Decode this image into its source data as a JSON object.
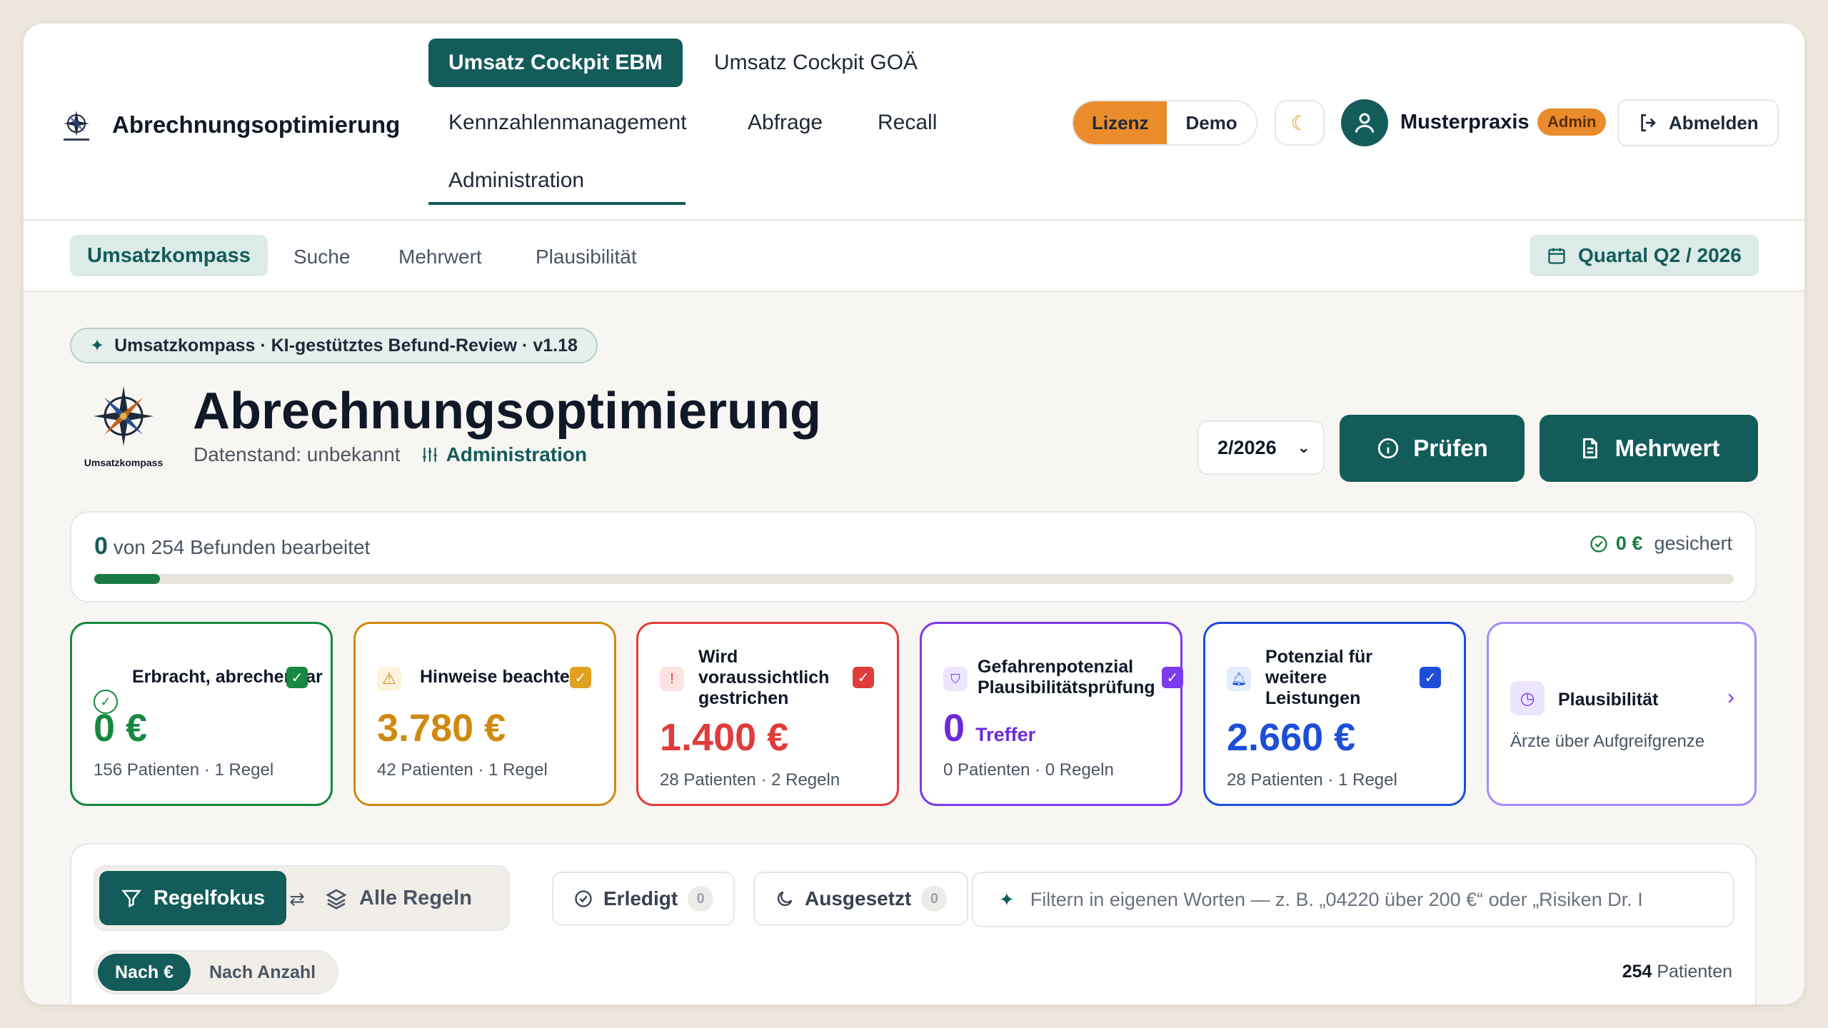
{
  "app": {
    "title": "Abrechnungsoptimierung"
  },
  "nav": {
    "umsatz_ebm": "Umsatz Cockpit EBM",
    "umsatz_goa": "Umsatz Cockpit GOÄ",
    "kennzahlen": "Kennzahlenmanagement",
    "abfrage": "Abfrage",
    "recall": "Recall",
    "administration": "Administration"
  },
  "header": {
    "lizenz": "Lizenz",
    "demo": "Demo",
    "user_name": "Musterpraxis",
    "role_badge": "Admin",
    "logout": "Abmelden"
  },
  "subnav": {
    "tabs": [
      "Umsatzkompass",
      "Suche",
      "Mehrwert",
      "Plausibilität"
    ],
    "quarter": "Quartal Q2 / 2026"
  },
  "hero": {
    "chip": "Umsatzkompass · KI-gestütztes Befund-Review · v1.18",
    "logo_label": "Umsatzkompass",
    "title": "Abrechnungsoptimierung",
    "datenstand": "Datenstand: unbekannt",
    "admin_link": "Administration",
    "period_select": "2/2026",
    "pruefen": "Prüfen",
    "mehrwert": "Mehrwert"
  },
  "progress": {
    "count": "0",
    "text": "von 254 Befunden bearbeitet",
    "secured_value": "0 €",
    "secured_label": "gesichert",
    "fraction": 0.04
  },
  "kpis": [
    {
      "title": "Erbracht, abrechenbar",
      "value": "0 €",
      "sub": "156 Patienten · 1 Regel",
      "color": "#16883f"
    },
    {
      "title": "Hinweise beachten",
      "value": "3.780 €",
      "sub": "42 Patienten · 1 Regel",
      "color": "#d08a10"
    },
    {
      "title": "Wird voraussichtlich gestrichen",
      "value": "1.400 €",
      "sub": "28 Patienten · 2 Regeln",
      "color": "#e03c3c"
    },
    {
      "title": "Gefahrenpotenzial Plausibilitätsprüfung",
      "value": "0",
      "value_suffix": "Treffer",
      "sub": "0 Patienten · 0 Regeln",
      "color": "#7c3aed"
    },
    {
      "title": "Potenzial für weitere Leistungen",
      "value": "2.660 €",
      "sub": "28 Patienten · 1 Regel",
      "color": "#1d4ed8"
    },
    {
      "title": "Plausibilität",
      "sub": "Ärzte über Aufgreifgrenze",
      "color": "#a78bfa"
    }
  ],
  "filters": {
    "regelfokus": "Regelfokus",
    "alle_regeln": "Alle Regeln",
    "erledigt": "Erledigt",
    "erledigt_count": "0",
    "ausgesetzt": "Ausgesetzt",
    "ausgesetzt_count": "0",
    "search_placeholder": "Filtern in eigenen Worten — z. B. „04220 über 200 €“ oder „Risiken Dr. I",
    "sort_euro": "Nach €",
    "sort_anzahl": "Nach Anzahl",
    "patient_count": "254",
    "patient_label": "Patienten"
  }
}
